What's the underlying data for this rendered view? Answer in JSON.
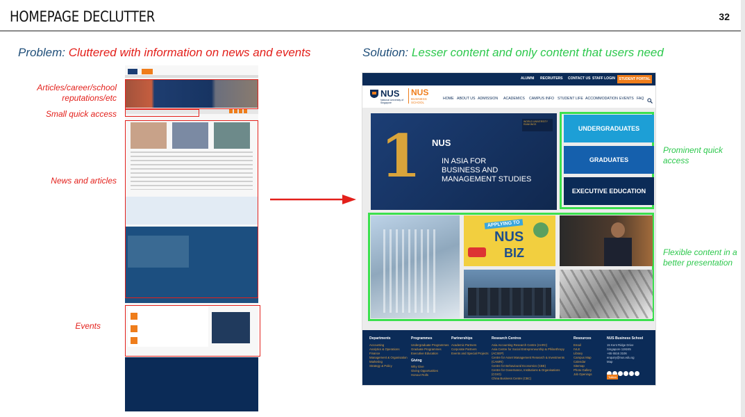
{
  "slide": {
    "title": "HOMEPAGE DECLUTTER",
    "page_number": "32"
  },
  "problem": {
    "label": "Problem:",
    "text": "Cluttered with information on news and events"
  },
  "solution": {
    "label": "Solution:",
    "text": "Lesser content and only content that users need"
  },
  "annotations_left": {
    "articles": "Articles/career/school reputations/etc",
    "quick_access": "Small quick access",
    "news": "News and articles",
    "events": "Events"
  },
  "annotations_right": {
    "prominent": "Prominent quick access",
    "flexible": "Flexible content in a better presentation"
  },
  "new_site": {
    "topbar": [
      "ALUMNI",
      "RECRUITERS",
      "CONTACT US",
      "STAFF LOGIN"
    ],
    "portal": "STUDENT PORTAL",
    "logo": "NUS",
    "logo_sub": "National University of Singapore",
    "school": "NUS",
    "school_sub": "BUSINESS SCHOOL",
    "nav": [
      "HOME",
      "ABOUT US",
      "ADMISSION",
      "ACADEMICS",
      "CAMPUS INFO",
      "STUDENT LIFE",
      "ACCOMMODATION",
      "EVENTS",
      "FAQ"
    ],
    "hero_line1": "IN ASIA FOR",
    "hero_line2": "BUSINESS AND",
    "hero_line3": "MANAGEMENT STUDIES",
    "hero_brand": "NUS",
    "hero_number": "1",
    "hero_rank": "WORLD UNIVERSITY RANKINGS",
    "quick_access": [
      "UNDERGRADUATES",
      "GRADUATES",
      "EXECUTIVE EDUCATION"
    ],
    "tile_text": [
      "APPLYING TO",
      "NUS",
      "BIZ"
    ],
    "footer_heads": [
      "Departments",
      "Programmes",
      "Partnerships",
      "Research Centres",
      "Resources",
      "NUS Business School"
    ],
    "footer_cols": [
      "Accounting\nAnalytics & Operations\nFinance\nManagement & Organisation\nMarketing\nStrategy & Policy",
      "Undergraduate Programmes\nGraduate Programmes\nExecutive Education",
      "Academic Partners\nCorporate Partners\nEvents and Special Projects",
      "Asia Accounting Research Centre (AARC)\nAsia Centre for Social Entrepreneurship & Philanthropy (ACSEP)\nCentre for Asset Management Research & Investments (CAMRI)\nCentre for Behavioural Economics (CBE)\nCentre for Governance, Institutions & Organisations (CGIO)\nChina Business Centre (CBC)",
      "Email\nIVLE\nLibrary\nCampus Map\nCalendar\nSitemap\nPhoto Gallery\nJob Openings",
      "15 Kent Ridge Drive\nSingapore 119245\n+65 6516 3106\nenquiry@nus.edu.sg\nMap"
    ],
    "giving_head": "Giving",
    "giving": "Why Give\nGiving Opportunities\nHonour Rolls",
    "footer_button": "Tuition"
  },
  "colors": {
    "problem_red": "#e3201b",
    "solution_green": "#2dc84d",
    "nus_navy": "#0b2b57",
    "nus_orange": "#ef7d1b",
    "quick_access_blue": "#1560ad"
  }
}
